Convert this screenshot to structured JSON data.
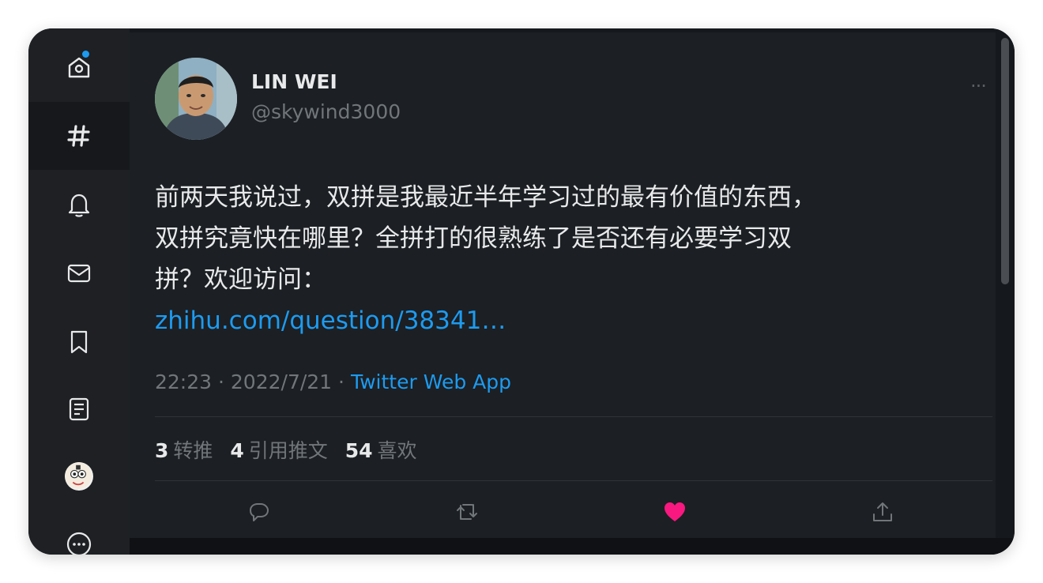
{
  "sidebar": {
    "items": [
      {
        "icon": "home-icon",
        "has_notification": true
      },
      {
        "icon": "hashtag-icon",
        "active": true
      },
      {
        "icon": "bell-icon"
      },
      {
        "icon": "mail-icon"
      },
      {
        "icon": "bookmark-icon"
      },
      {
        "icon": "list-icon"
      },
      {
        "icon": "profile-avatar"
      },
      {
        "icon": "more-circle-icon"
      }
    ]
  },
  "tweet": {
    "author_name": "LIN WEI",
    "author_handle": "@skywind3000",
    "more_label": "···",
    "text_lines": [
      "前两天我说过，双拼是我最近半年学习过的最有价值的东西，",
      "双拼究竟快在哪里？全拼打的很熟练了是否还有必要学习双",
      "拼？欢迎访问："
    ],
    "link_text": "zhihu.com/question/38341…",
    "time": "22:23",
    "date": "2022/7/21",
    "separator": "·",
    "app": "Twitter Web App",
    "stats": {
      "retweets_count": "3",
      "retweets_label": "转推",
      "quotes_count": "4",
      "quotes_label": "引用推文",
      "likes_count": "54",
      "likes_label": "喜欢"
    },
    "actions": [
      "reply-icon",
      "retweet-icon",
      "like-icon",
      "share-icon"
    ],
    "liked": true
  },
  "colors": {
    "accent": "#1d9bf0",
    "like": "#f91880",
    "background": "#1c1f23",
    "text": "#e7e9ea",
    "muted": "#71767b"
  }
}
